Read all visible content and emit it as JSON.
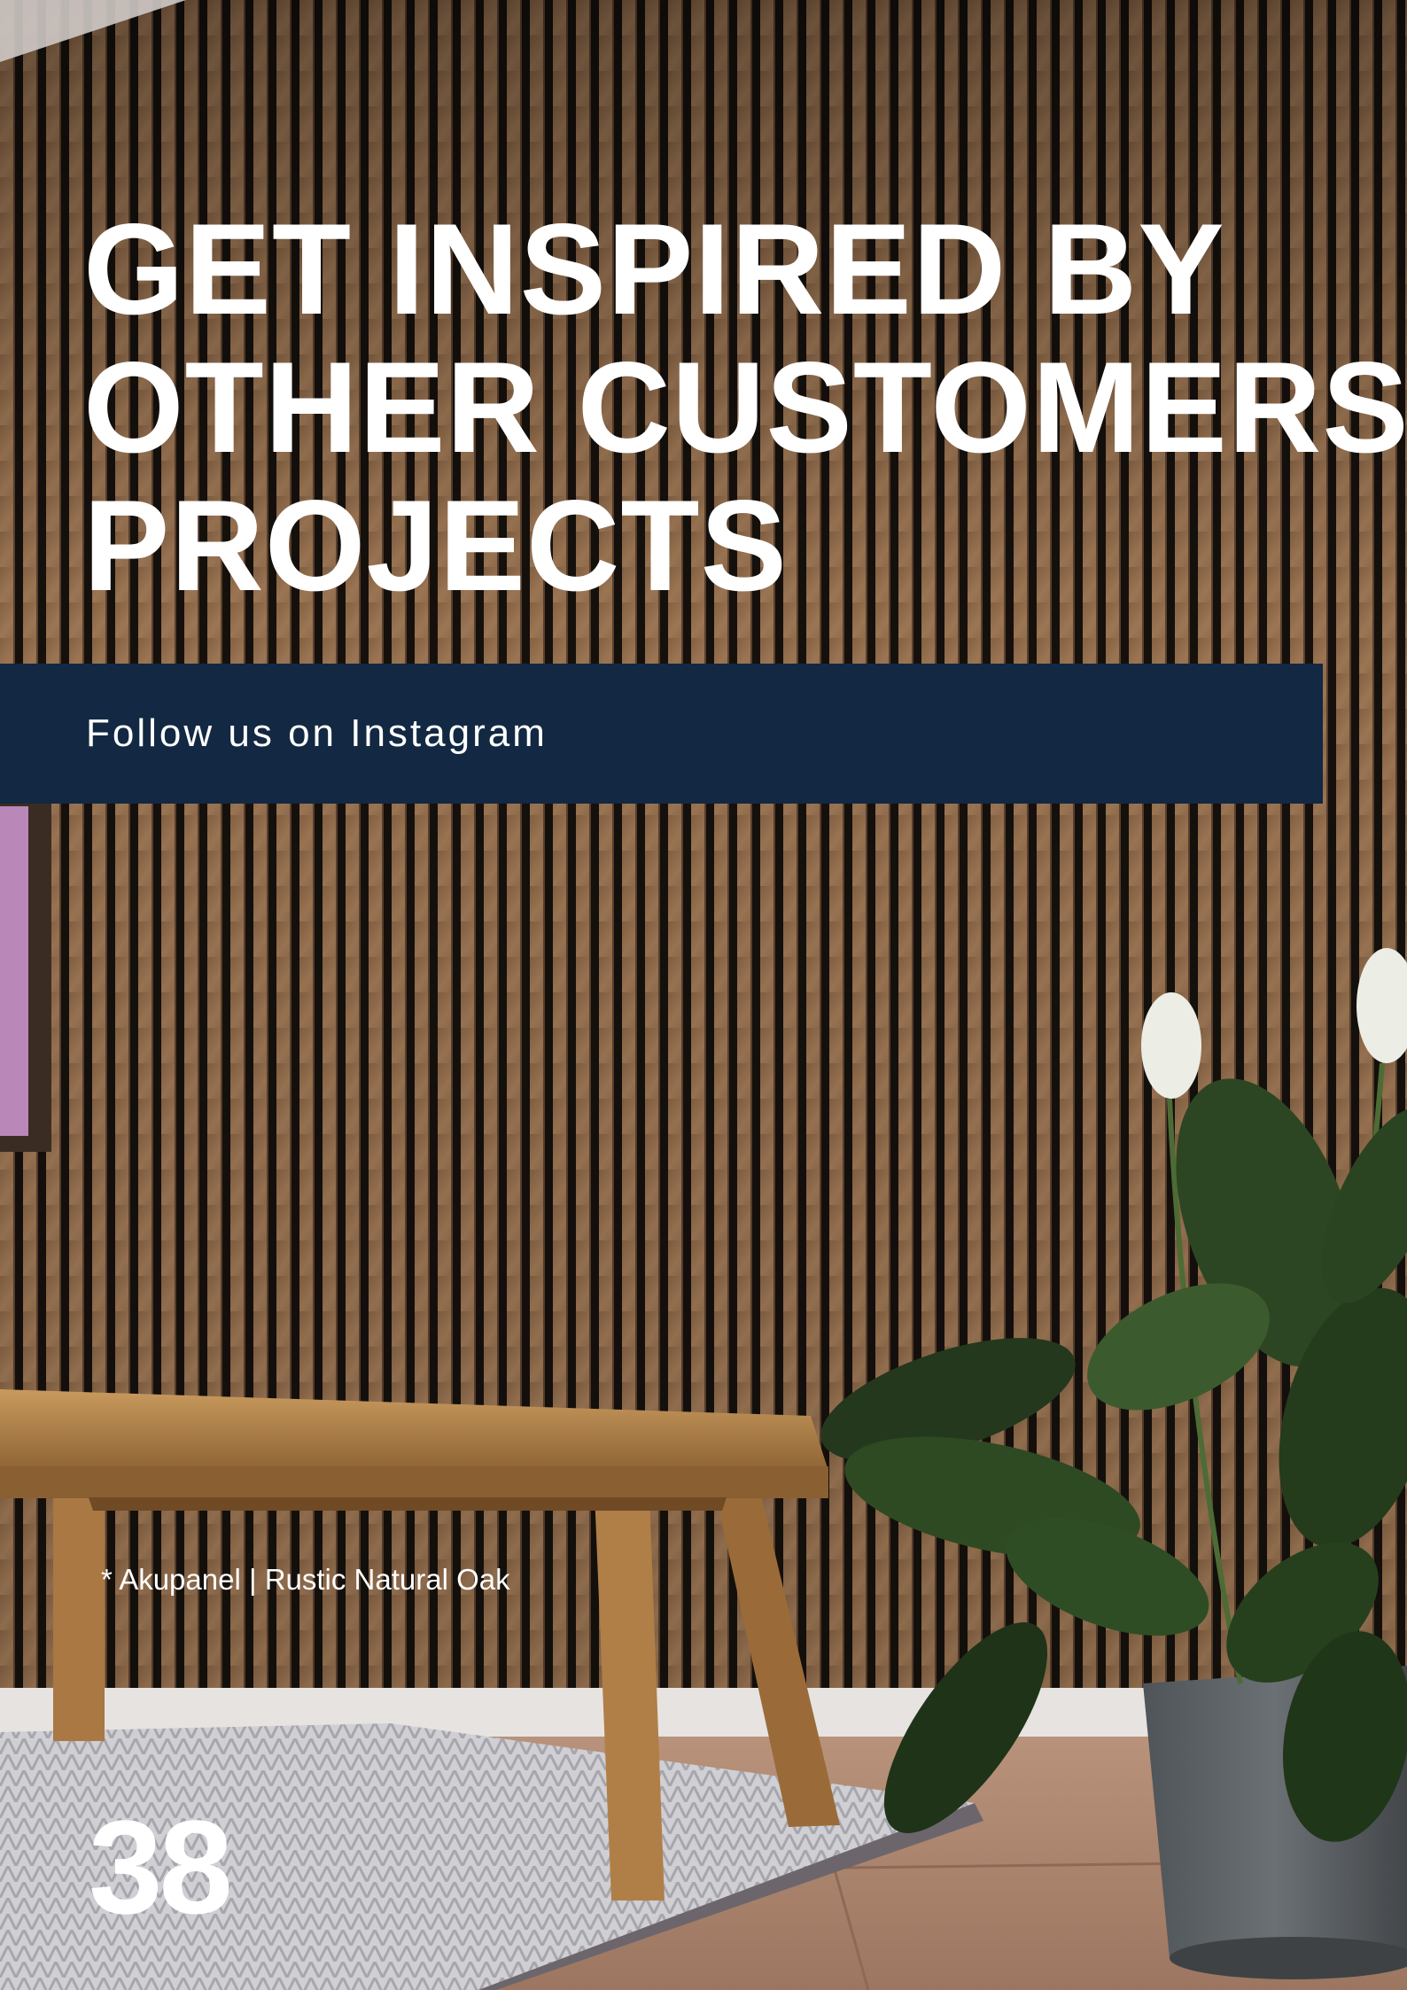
{
  "headline": {
    "line1": "GET INSPIRED BY",
    "line2": "OTHER CUSTOMERS’",
    "line3": "PROJECTS"
  },
  "banner": {
    "text": "Follow us on Instagram",
    "color": "#132842"
  },
  "caption": "* Akupanel | Rustic Natural Oak",
  "page_number": "38",
  "colors": {
    "wood": "#9a7350",
    "slat_gap": "#15100c",
    "text": "#ffffff"
  }
}
